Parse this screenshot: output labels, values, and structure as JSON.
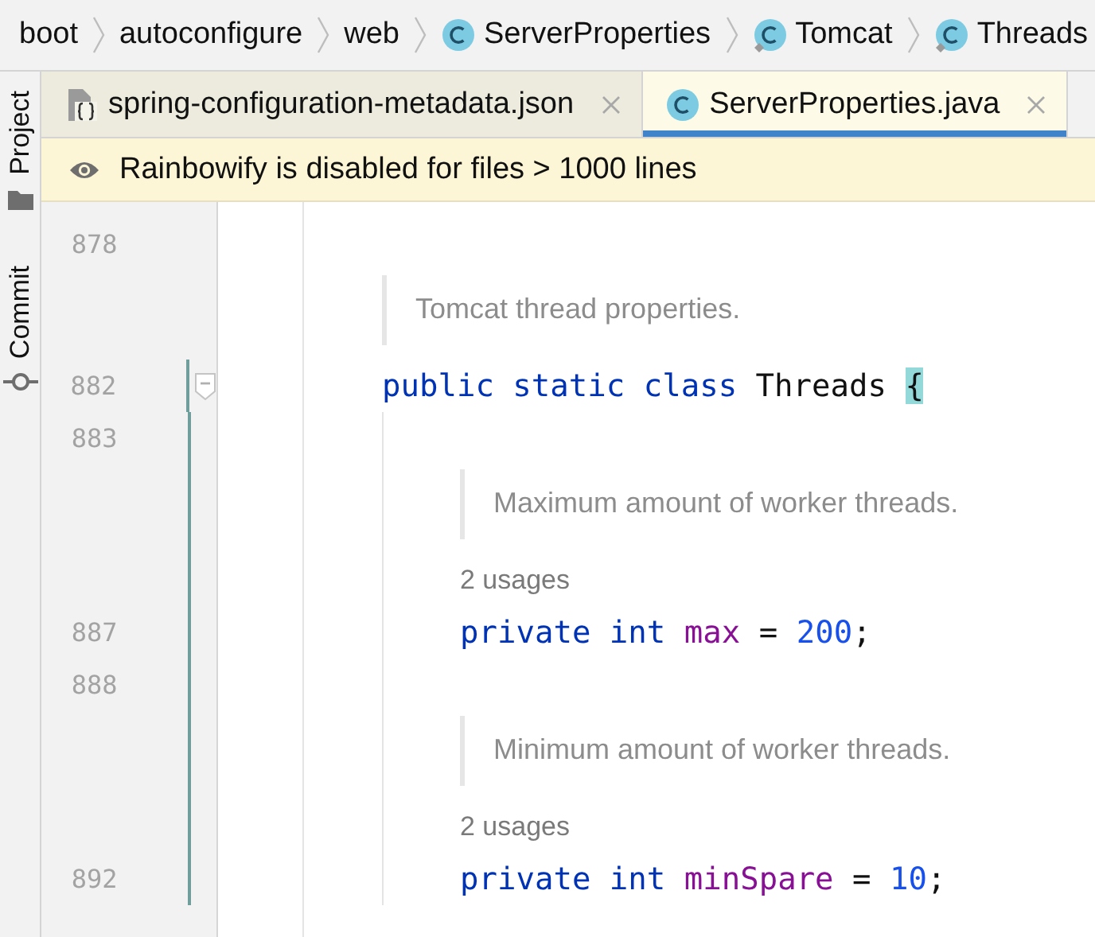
{
  "breadcrumbs": [
    {
      "label": "boot",
      "kind": "package"
    },
    {
      "label": "autoconfigure",
      "kind": "package"
    },
    {
      "label": "web",
      "kind": "package"
    },
    {
      "label": "ServerProperties",
      "kind": "class"
    },
    {
      "label": "Tomcat",
      "kind": "inner-class"
    },
    {
      "label": "Threads",
      "kind": "inner-class"
    }
  ],
  "tool_strip": [
    {
      "label": "Project",
      "kind": "folder"
    },
    {
      "label": "Commit",
      "kind": "commit"
    }
  ],
  "tabs": [
    {
      "label": "spring-configuration-metadata.json",
      "kind": "json",
      "selected": false
    },
    {
      "label": "ServerProperties.java",
      "kind": "class",
      "selected": true
    }
  ],
  "notification": {
    "text": "Rainbowify is disabled for files > 1000 lines"
  },
  "editor": {
    "lines": [
      {
        "kind": "blank",
        "number": "878",
        "changed": false
      },
      {
        "kind": "doc",
        "text": "Tomcat thread properties.",
        "changed": false
      },
      {
        "kind": "code",
        "number": "882",
        "changed": true,
        "foldable": true,
        "tokens": [
          {
            "kind": "keyword",
            "text": "public static class"
          },
          {
            "kind": "plain",
            "text": " Threads "
          },
          {
            "kind": "match",
            "text": "{"
          }
        ],
        "children": [
          {
            "kind": "blank",
            "number": "883",
            "changed": true
          },
          {
            "kind": "doc",
            "text": "Maximum amount of worker threads.",
            "changed": true
          },
          {
            "kind": "usages",
            "text": "2 usages",
            "changed": true
          },
          {
            "kind": "code",
            "number": "887",
            "changed": true,
            "foldable": false,
            "tokens": [
              {
                "kind": "keyword",
                "text": "private int"
              },
              {
                "kind": "field",
                "text": " max"
              },
              {
                "kind": "plain",
                "text": " = "
              },
              {
                "kind": "number",
                "text": "200"
              },
              {
                "kind": "plain",
                "text": ";"
              }
            ]
          },
          {
            "kind": "blank",
            "number": "888",
            "changed": true
          },
          {
            "kind": "doc",
            "text": "Minimum amount of worker threads.",
            "changed": true
          },
          {
            "kind": "usages",
            "text": "2 usages",
            "changed": true
          },
          {
            "kind": "code",
            "number": "892",
            "changed": true,
            "foldable": false,
            "tokens": [
              {
                "kind": "keyword",
                "text": "private int"
              },
              {
                "kind": "field",
                "text": " minSpare"
              },
              {
                "kind": "plain",
                "text": " = "
              },
              {
                "kind": "number",
                "text": "10"
              },
              {
                "kind": "plain",
                "text": ";"
              }
            ]
          }
        ]
      }
    ]
  }
}
